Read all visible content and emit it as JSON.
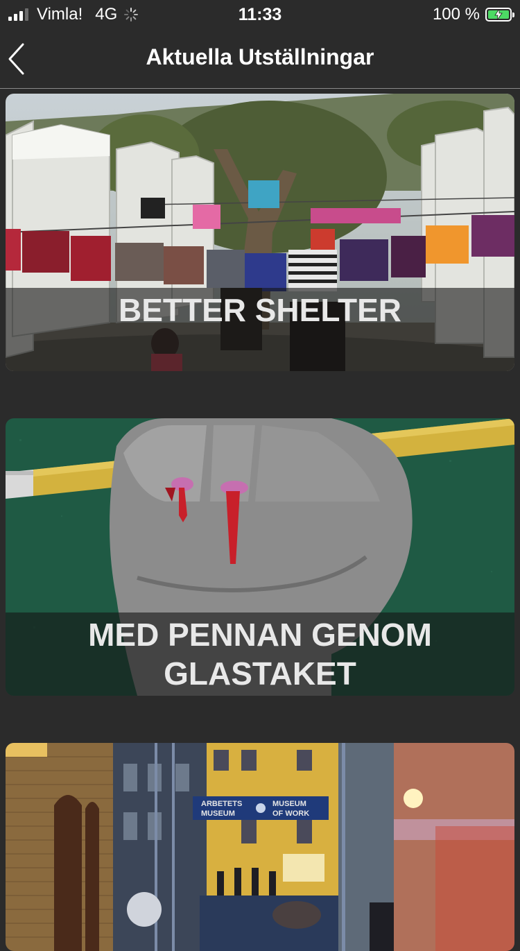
{
  "status_bar": {
    "carrier": "Vimla!",
    "network": "4G",
    "time": "11:33",
    "battery": "100 %",
    "battery_color": "#4cd964"
  },
  "nav": {
    "back_icon": "chevron-left-icon",
    "title": "Aktuella Utställningar"
  },
  "exhibitions": [
    {
      "title": "BETTER SHELTER"
    },
    {
      "title": "MED PENNAN GENOM GLASTAKET"
    },
    {
      "title": "",
      "sign_text": [
        "ARBETETS",
        "MUSEUM",
        "MUSEUM",
        "OF WORK"
      ]
    }
  ]
}
